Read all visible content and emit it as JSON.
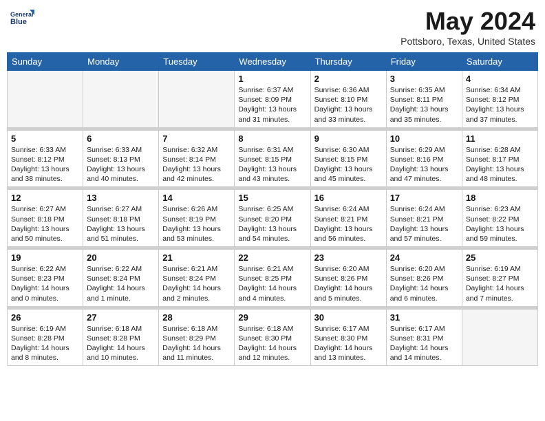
{
  "header": {
    "logo_line1": "General",
    "logo_line2": "Blue",
    "month": "May 2024",
    "location": "Pottsboro, Texas, United States"
  },
  "weekdays": [
    "Sunday",
    "Monday",
    "Tuesday",
    "Wednesday",
    "Thursday",
    "Friday",
    "Saturday"
  ],
  "weeks": [
    [
      {
        "day": "",
        "info": ""
      },
      {
        "day": "",
        "info": ""
      },
      {
        "day": "",
        "info": ""
      },
      {
        "day": "1",
        "info": "Sunrise: 6:37 AM\nSunset: 8:09 PM\nDaylight: 13 hours\nand 31 minutes."
      },
      {
        "day": "2",
        "info": "Sunrise: 6:36 AM\nSunset: 8:10 PM\nDaylight: 13 hours\nand 33 minutes."
      },
      {
        "day": "3",
        "info": "Sunrise: 6:35 AM\nSunset: 8:11 PM\nDaylight: 13 hours\nand 35 minutes."
      },
      {
        "day": "4",
        "info": "Sunrise: 6:34 AM\nSunset: 8:12 PM\nDaylight: 13 hours\nand 37 minutes."
      }
    ],
    [
      {
        "day": "5",
        "info": "Sunrise: 6:33 AM\nSunset: 8:12 PM\nDaylight: 13 hours\nand 38 minutes."
      },
      {
        "day": "6",
        "info": "Sunrise: 6:33 AM\nSunset: 8:13 PM\nDaylight: 13 hours\nand 40 minutes."
      },
      {
        "day": "7",
        "info": "Sunrise: 6:32 AM\nSunset: 8:14 PM\nDaylight: 13 hours\nand 42 minutes."
      },
      {
        "day": "8",
        "info": "Sunrise: 6:31 AM\nSunset: 8:15 PM\nDaylight: 13 hours\nand 43 minutes."
      },
      {
        "day": "9",
        "info": "Sunrise: 6:30 AM\nSunset: 8:15 PM\nDaylight: 13 hours\nand 45 minutes."
      },
      {
        "day": "10",
        "info": "Sunrise: 6:29 AM\nSunset: 8:16 PM\nDaylight: 13 hours\nand 47 minutes."
      },
      {
        "day": "11",
        "info": "Sunrise: 6:28 AM\nSunset: 8:17 PM\nDaylight: 13 hours\nand 48 minutes."
      }
    ],
    [
      {
        "day": "12",
        "info": "Sunrise: 6:27 AM\nSunset: 8:18 PM\nDaylight: 13 hours\nand 50 minutes."
      },
      {
        "day": "13",
        "info": "Sunrise: 6:27 AM\nSunset: 8:18 PM\nDaylight: 13 hours\nand 51 minutes."
      },
      {
        "day": "14",
        "info": "Sunrise: 6:26 AM\nSunset: 8:19 PM\nDaylight: 13 hours\nand 53 minutes."
      },
      {
        "day": "15",
        "info": "Sunrise: 6:25 AM\nSunset: 8:20 PM\nDaylight: 13 hours\nand 54 minutes."
      },
      {
        "day": "16",
        "info": "Sunrise: 6:24 AM\nSunset: 8:21 PM\nDaylight: 13 hours\nand 56 minutes."
      },
      {
        "day": "17",
        "info": "Sunrise: 6:24 AM\nSunset: 8:21 PM\nDaylight: 13 hours\nand 57 minutes."
      },
      {
        "day": "18",
        "info": "Sunrise: 6:23 AM\nSunset: 8:22 PM\nDaylight: 13 hours\nand 59 minutes."
      }
    ],
    [
      {
        "day": "19",
        "info": "Sunrise: 6:22 AM\nSunset: 8:23 PM\nDaylight: 14 hours\nand 0 minutes."
      },
      {
        "day": "20",
        "info": "Sunrise: 6:22 AM\nSunset: 8:24 PM\nDaylight: 14 hours\nand 1 minute."
      },
      {
        "day": "21",
        "info": "Sunrise: 6:21 AM\nSunset: 8:24 PM\nDaylight: 14 hours\nand 2 minutes."
      },
      {
        "day": "22",
        "info": "Sunrise: 6:21 AM\nSunset: 8:25 PM\nDaylight: 14 hours\nand 4 minutes."
      },
      {
        "day": "23",
        "info": "Sunrise: 6:20 AM\nSunset: 8:26 PM\nDaylight: 14 hours\nand 5 minutes."
      },
      {
        "day": "24",
        "info": "Sunrise: 6:20 AM\nSunset: 8:26 PM\nDaylight: 14 hours\nand 6 minutes."
      },
      {
        "day": "25",
        "info": "Sunrise: 6:19 AM\nSunset: 8:27 PM\nDaylight: 14 hours\nand 7 minutes."
      }
    ],
    [
      {
        "day": "26",
        "info": "Sunrise: 6:19 AM\nSunset: 8:28 PM\nDaylight: 14 hours\nand 8 minutes."
      },
      {
        "day": "27",
        "info": "Sunrise: 6:18 AM\nSunset: 8:28 PM\nDaylight: 14 hours\nand 10 minutes."
      },
      {
        "day": "28",
        "info": "Sunrise: 6:18 AM\nSunset: 8:29 PM\nDaylight: 14 hours\nand 11 minutes."
      },
      {
        "day": "29",
        "info": "Sunrise: 6:18 AM\nSunset: 8:30 PM\nDaylight: 14 hours\nand 12 minutes."
      },
      {
        "day": "30",
        "info": "Sunrise: 6:17 AM\nSunset: 8:30 PM\nDaylight: 14 hours\nand 13 minutes."
      },
      {
        "day": "31",
        "info": "Sunrise: 6:17 AM\nSunset: 8:31 PM\nDaylight: 14 hours\nand 14 minutes."
      },
      {
        "day": "",
        "info": ""
      }
    ]
  ]
}
